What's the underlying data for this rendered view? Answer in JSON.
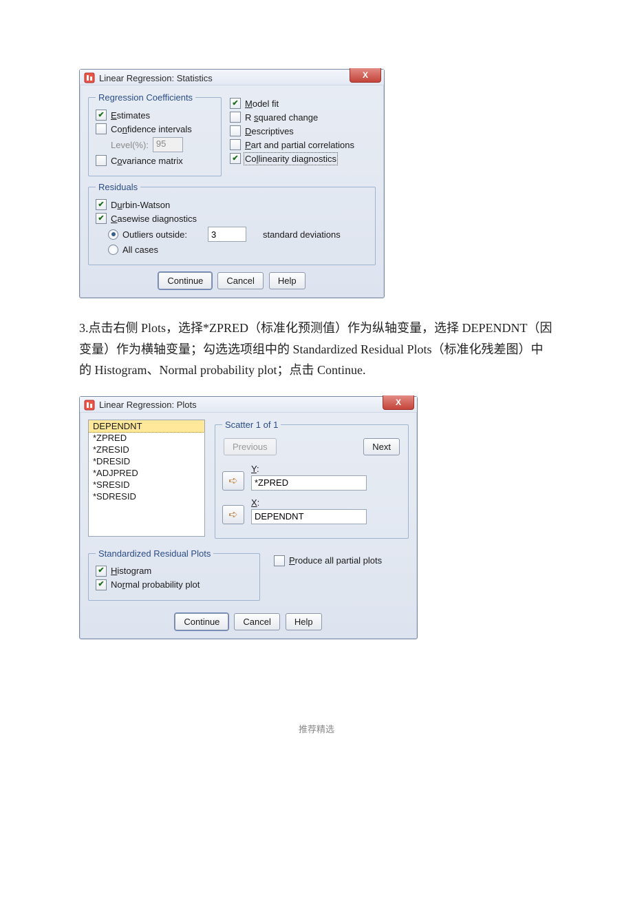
{
  "statistics_dialog": {
    "title": "Linear Regression: Statistics",
    "close": "X",
    "reg_coef": {
      "legend": "Regression Coefficients",
      "estimates": "Estimates",
      "confidence": "Confidence intervals",
      "level_label": "Level(%):",
      "level_value": "95",
      "covariance": "Covariance matrix"
    },
    "right": {
      "model_fit": "Model fit",
      "r_squared": "R squared change",
      "descriptives": "Descriptives",
      "part_partial": "Part and partial correlations",
      "collinearity": "Collinearity diagnostics"
    },
    "residuals": {
      "legend": "Residuals",
      "durbin": "Durbin-Watson",
      "casewise": "Casewise diagnostics",
      "outliers": "Outliers outside:",
      "outliers_value": "3",
      "std_dev": "standard deviations",
      "all_cases": "All cases"
    },
    "buttons": {
      "continue": "Continue",
      "cancel": "Cancel",
      "help": "Help"
    }
  },
  "body_text": "3.点击右侧 Plots，选择*ZPRED（标准化预测值）作为纵轴变量，选择 DEPENDNT（因变量）作为横轴变量；勾选选项组中的 Standardized Residual Plots（标准化残差图）中的 Histogram、Normal probability plot；点击 Continue.",
  "plots_dialog": {
    "title": "Linear Regression: Plots",
    "close": "X",
    "list": [
      "DEPENDNT",
      "*ZPRED",
      "*ZRESID",
      "*DRESID",
      "*ADJPRED",
      "*SRESID",
      "*SDRESID"
    ],
    "list_selected": "DEPENDNT",
    "scatter": {
      "legend": "Scatter 1 of 1",
      "previous": "Previous",
      "next": "Next",
      "y_label": "Y:",
      "y_value": "*ZPRED",
      "x_label": "X:",
      "x_value": "DEPENDNT"
    },
    "srp": {
      "legend": "Standardized Residual Plots",
      "histogram": "Histogram",
      "normal": "Normal probability plot"
    },
    "partial": "Produce all partial plots",
    "buttons": {
      "continue": "Continue",
      "cancel": "Cancel",
      "help": "Help"
    }
  },
  "footer": "推荐精选"
}
